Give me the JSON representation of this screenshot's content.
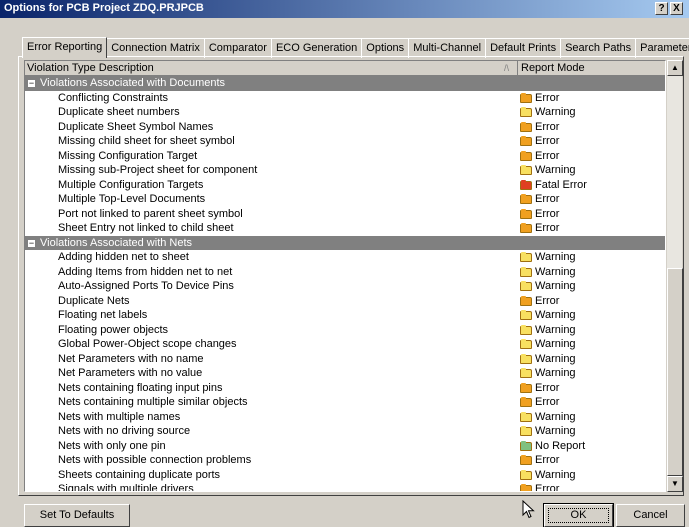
{
  "window": {
    "title": "Options for PCB Project ZDQ.PRJPCB",
    "help_btn": "?",
    "close_btn": "X"
  },
  "tabs": [
    "Error Reporting",
    "Connection Matrix",
    "Comparator",
    "ECO Generation",
    "Options",
    "Multi-Channel",
    "Default Prints",
    "Search Paths",
    "Parameters"
  ],
  "grid": {
    "col_description": "Violation Type Description",
    "col_mode": "Report Mode",
    "sort_indicator": "/\\"
  },
  "colors": {
    "Error": "#f0a020",
    "Warning": "#f8e060",
    "Fatal Error": "#e04020",
    "No Report": "#80c080"
  },
  "rows": [
    {
      "type": "group",
      "label": "Violations Associated with Documents",
      "expander": "−"
    },
    {
      "type": "item",
      "label": "Conflicting Constraints",
      "mode": "Error"
    },
    {
      "type": "item",
      "label": "Duplicate sheet numbers",
      "mode": "Warning"
    },
    {
      "type": "item",
      "label": "Duplicate Sheet Symbol Names",
      "mode": "Error"
    },
    {
      "type": "item",
      "label": "Missing child sheet for sheet symbol",
      "mode": "Error"
    },
    {
      "type": "item",
      "label": "Missing Configuration Target",
      "mode": "Error"
    },
    {
      "type": "item",
      "label": "Missing sub-Project sheet for component",
      "mode": "Warning"
    },
    {
      "type": "item",
      "label": "Multiple Configuration Targets",
      "mode": "Fatal Error"
    },
    {
      "type": "item",
      "label": "Multiple Top-Level Documents",
      "mode": "Error"
    },
    {
      "type": "item",
      "label": "Port not linked to parent sheet symbol",
      "mode": "Error"
    },
    {
      "type": "item",
      "label": "Sheet Entry not linked to child sheet",
      "mode": "Error"
    },
    {
      "type": "group",
      "label": "Violations Associated with Nets",
      "expander": "−"
    },
    {
      "type": "item",
      "label": "Adding hidden net to sheet",
      "mode": "Warning"
    },
    {
      "type": "item",
      "label": "Adding Items from hidden net to net",
      "mode": "Warning"
    },
    {
      "type": "item",
      "label": "Auto-Assigned Ports To Device Pins",
      "mode": "Warning"
    },
    {
      "type": "item",
      "label": "Duplicate Nets",
      "mode": "Error"
    },
    {
      "type": "item",
      "label": "Floating net labels",
      "mode": "Warning"
    },
    {
      "type": "item",
      "label": "Floating power objects",
      "mode": "Warning"
    },
    {
      "type": "item",
      "label": "Global Power-Object scope changes",
      "mode": "Warning"
    },
    {
      "type": "item",
      "label": "Net Parameters with no name",
      "mode": "Warning"
    },
    {
      "type": "item",
      "label": "Net Parameters with no value",
      "mode": "Warning"
    },
    {
      "type": "item",
      "label": "Nets containing floating input pins",
      "mode": "Error"
    },
    {
      "type": "item",
      "label": "Nets containing multiple similar objects",
      "mode": "Error"
    },
    {
      "type": "item",
      "label": "Nets with multiple names",
      "mode": "Warning"
    },
    {
      "type": "item",
      "label": "Nets with no driving source",
      "mode": "Warning"
    },
    {
      "type": "item",
      "label": "Nets with only one pin",
      "mode": "No Report"
    },
    {
      "type": "item",
      "label": "Nets with possible connection problems",
      "mode": "Error"
    },
    {
      "type": "item",
      "label": "Sheets containing duplicate ports",
      "mode": "Warning"
    },
    {
      "type": "item",
      "label": "Signals with multiple drivers",
      "mode": "Error"
    }
  ],
  "buttons": {
    "defaults": "Set To Defaults",
    "ok": "OK",
    "cancel": "Cancel"
  }
}
